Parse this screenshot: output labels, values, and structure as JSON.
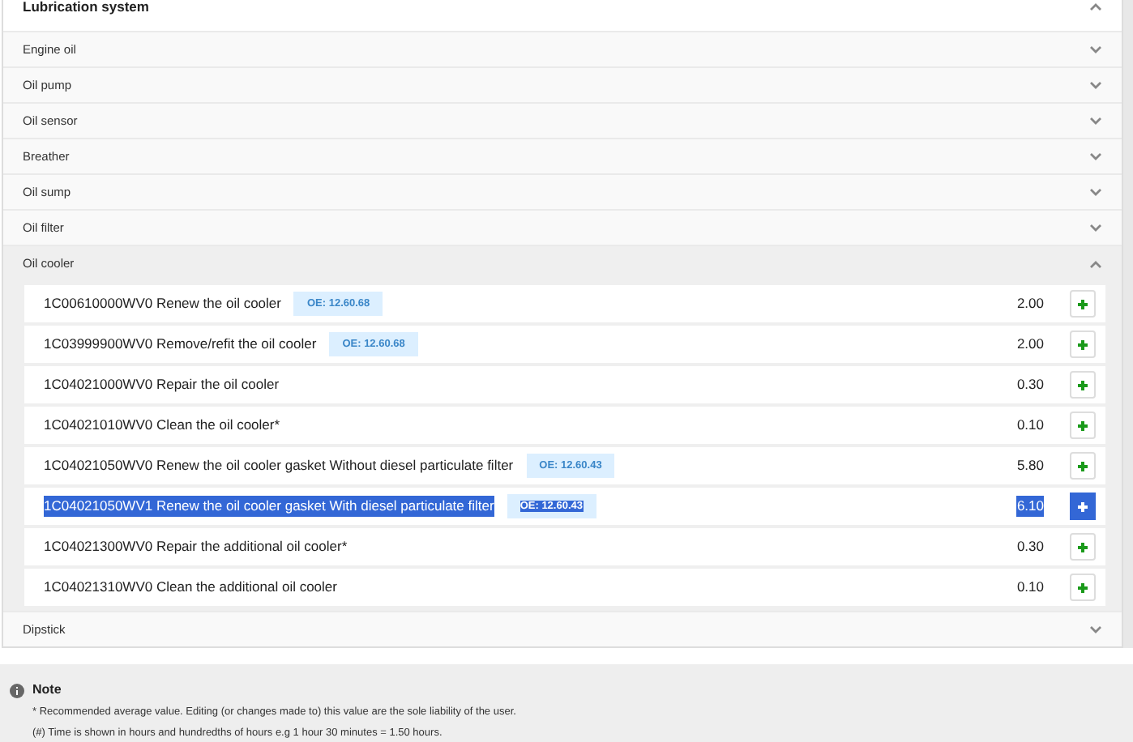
{
  "group": {
    "title": "Lubrication system",
    "expanded": true,
    "sections": [
      {
        "title": "Engine oil",
        "expanded": false
      },
      {
        "title": "Oil pump",
        "expanded": false
      },
      {
        "title": "Oil sensor",
        "expanded": false
      },
      {
        "title": "Breather",
        "expanded": false
      },
      {
        "title": "Oil sump",
        "expanded": false
      },
      {
        "title": "Oil filter",
        "expanded": false
      },
      {
        "title": "Oil cooler",
        "expanded": true,
        "operations": [
          {
            "description": "1C00610000WV0 Renew the oil cooler",
            "oe": "OE: 12.60.68",
            "time": "2.00",
            "selected": false
          },
          {
            "description": "1C03999900WV0 Remove/refit the oil cooler",
            "oe": "OE: 12.60.68",
            "time": "2.00",
            "selected": false
          },
          {
            "description": "1C04021000WV0 Repair the oil cooler",
            "time": "0.30",
            "selected": false
          },
          {
            "description": "1C04021010WV0 Clean the oil cooler*",
            "time": "0.10",
            "selected": false
          },
          {
            "description": "1C04021050WV0 Renew the oil cooler gasket Without diesel particulate filter",
            "oe": "OE: 12.60.43",
            "time": "5.80",
            "selected": false
          },
          {
            "description": "1C04021050WV1 Renew the oil cooler gasket With diesel particulate filter",
            "oe": "OE: 12.60.43",
            "time": "6.10",
            "selected": true
          },
          {
            "description": "1C04021300WV0 Repair the additional oil cooler*",
            "time": "0.30",
            "selected": false
          },
          {
            "description": "1C04021310WV0 Clean the additional oil cooler",
            "time": "0.10",
            "selected": false
          }
        ]
      },
      {
        "title": "Dipstick",
        "expanded": false
      }
    ]
  },
  "note": {
    "title": "Note",
    "lines": [
      "* Recommended average value. Editing (or changes made to) this value are the sole liability of the user.",
      "(#) Time is shown in hours and hundredths of hours e.g 1 hour 30 minutes = 1.50 hours."
    ]
  }
}
